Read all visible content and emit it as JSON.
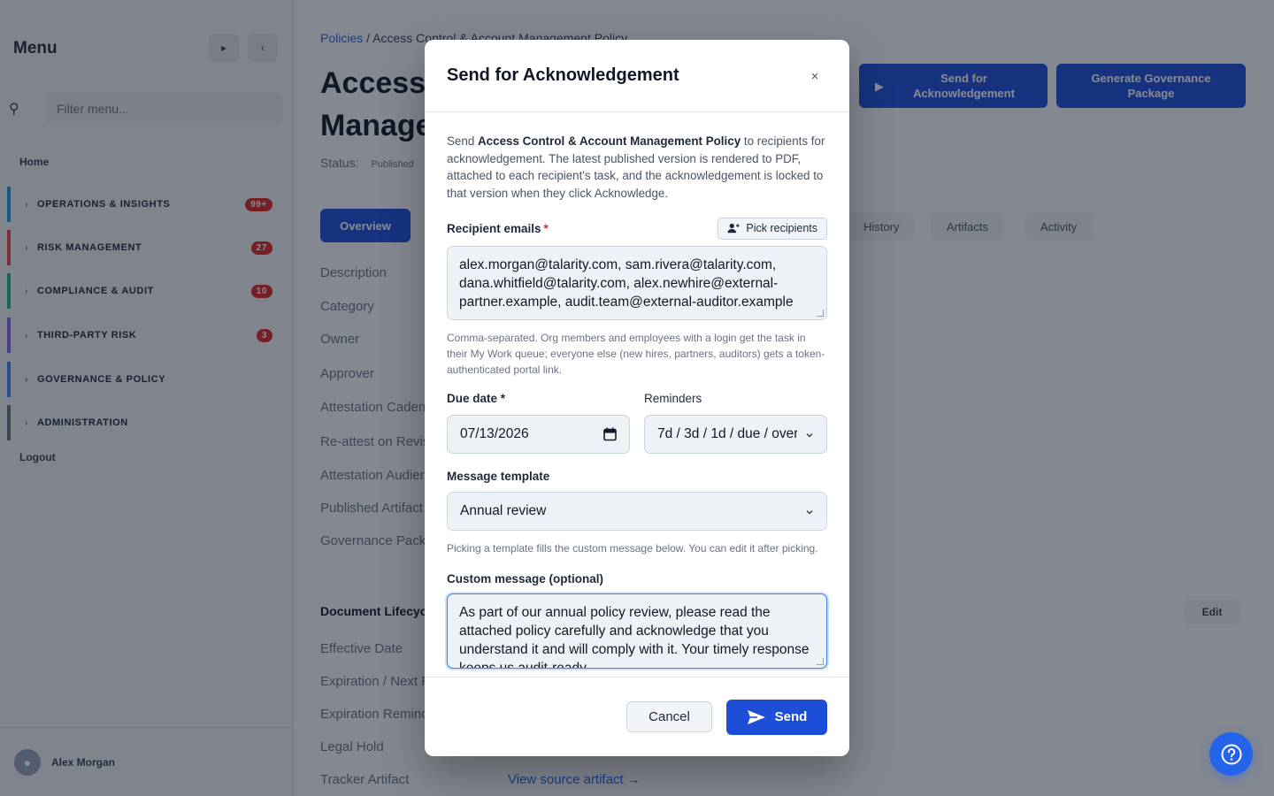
{
  "sidebar": {
    "title": "Menu",
    "filter_placeholder": "Filter menu...",
    "home": "Home",
    "sections": [
      {
        "label": "OPERATIONS & INSIGHTS",
        "badge": "99+",
        "color": "#0ea5e9"
      },
      {
        "label": "RISK MANAGEMENT",
        "badge": "27",
        "color": "#ef4444"
      },
      {
        "label": "COMPLIANCE & AUDIT",
        "badge": "10",
        "color": "#10b981"
      },
      {
        "label": "THIRD-PARTY RISK",
        "badge": "3",
        "color": "#8b5cf6"
      },
      {
        "label": "GOVERNANCE & POLICY",
        "badge": "",
        "color": "#3b82f6"
      },
      {
        "label": "ADMINISTRATION",
        "badge": "",
        "color": "#6b7280"
      }
    ],
    "logout": "Logout",
    "user_name": "Alex Morgan"
  },
  "page": {
    "breadcrumb_link": "Policies",
    "breadcrumb_sep": "/",
    "breadcrumb_current": "Access Control & Account Management Policy",
    "title": "Access Control & Account Management Policy",
    "status_label": "Status:",
    "status_value": "Published",
    "header_buttons": {
      "send": "Send for Acknowledgement",
      "generate": "Generate Governance Package"
    },
    "tabs": {
      "active": "Overview",
      "others": [
        "History",
        "Artifacts",
        "Activity"
      ]
    },
    "fields": [
      "Description",
      "Category",
      "Owner",
      "Approver",
      "Attestation Cadence",
      "Re-attest on Revision",
      "Attestation Audience",
      "Published Artifact",
      "Governance Package"
    ],
    "lifecycle_heading": "Document Lifecycle",
    "edit": "Edit",
    "lifecycle_fields": [
      "Effective Date",
      "Expiration / Next Review",
      "Expiration Reminder",
      "Legal Hold",
      "Tracker Artifact"
    ],
    "source_link": "View source artifact →"
  },
  "modal": {
    "title": "Send for Acknowledgement",
    "close": "×",
    "intro_prefix": "Send ",
    "intro_policy": "Access Control & Account Management Policy",
    "intro_suffix": " to recipients for acknowledgement. The latest published version is rendered to PDF, attached to each recipient's task, and the acknowledgement is locked to that version when they click Acknowledge.",
    "recipients_label": "Recipient emails",
    "required_mark": "*",
    "pick_recipients": "Pick recipients",
    "recipients_value": "alex.morgan@talarity.com, sam.rivera@talarity.com, dana.whitfield@talarity.com, alex.newhire@external-partner.example, audit.team@external-auditor.example",
    "recipients_hint": "Comma-separated. Org members and employees with a login get the task in their My Work queue; everyone else (new hires, partners, auditors) gets a token-authenticated portal link.",
    "due_date_label": "Due date *",
    "due_date_value": "07/13/2026",
    "reminders_label": "Reminders",
    "reminders_value": "7d / 3d / 1d / due / overdue",
    "template_label": "Message template",
    "template_value": "Annual review",
    "template_hint": "Picking a template fills the custom message below. You can edit it after picking.",
    "message_label": "Custom message (optional)",
    "message_value": "As part of our annual policy review, please read the attached policy carefully and acknowledge that you understand it and will comply with it. Your timely response keeps us audit-ready.",
    "cancel": "Cancel",
    "send": "Send"
  },
  "colors": {
    "primary": "#1d4ed8",
    "focus": "#3b82f6",
    "required": "#dc2626"
  },
  "icons": {
    "close": "close-icon",
    "pick": "user-plus-icon",
    "calendar": "calendar-icon",
    "chevron": "chevron-down-icon",
    "send": "paper-plane-icon",
    "help": "question-circle-icon"
  }
}
